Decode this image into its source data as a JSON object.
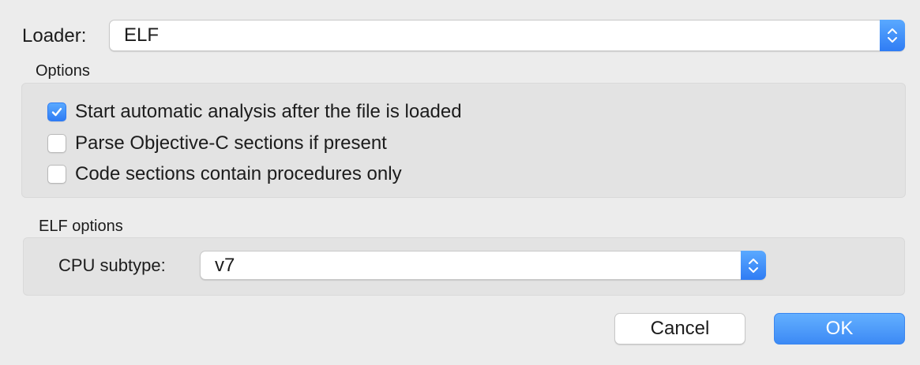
{
  "loader": {
    "label": "Loader:",
    "selected": "ELF"
  },
  "options": {
    "title": "Options",
    "checkboxes": [
      {
        "label": "Start automatic analysis after the file is loaded",
        "checked": true
      },
      {
        "label": "Parse Objective-C sections if present",
        "checked": false
      },
      {
        "label": "Code sections contain procedures only",
        "checked": false
      }
    ]
  },
  "elf_options": {
    "title": "ELF options",
    "cpu_subtype_label": "CPU subtype:",
    "cpu_subtype_selected": "v7"
  },
  "buttons": {
    "cancel": "Cancel",
    "ok": "OK"
  },
  "colors": {
    "accent": "#3c8af5",
    "background": "#ececec",
    "group_background": "#e3e3e3"
  },
  "icons": {
    "stepper": "up-down-chevron-icon",
    "check": "checkmark-icon"
  }
}
